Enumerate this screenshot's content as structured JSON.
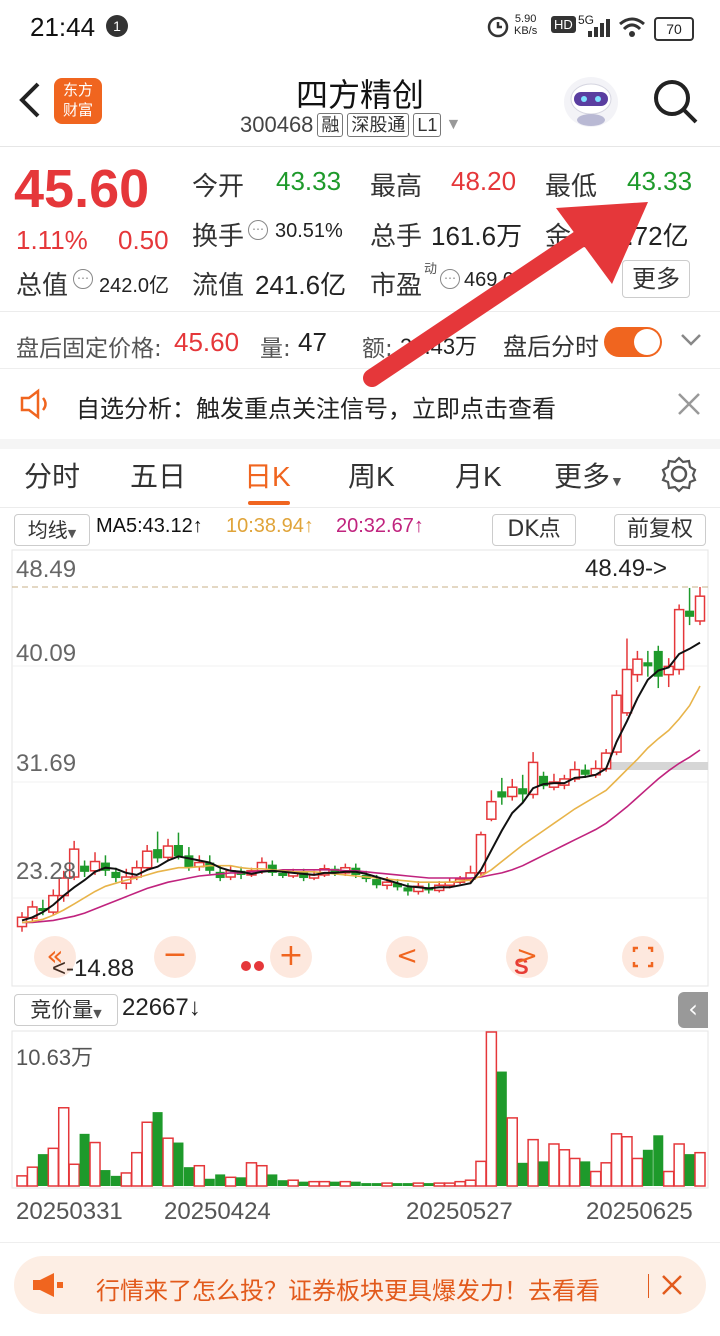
{
  "status_bar": {
    "time": "21:44",
    "notification_count": "1",
    "net_speed_value": "5.90",
    "net_speed_unit": "KB/s",
    "hd": "HD",
    "network": "5G",
    "battery": "70"
  },
  "header": {
    "back_icon": "chevron-left-icon",
    "logo_line1": "东方",
    "logo_line2": "财富",
    "title": "四方精创",
    "code": "300468",
    "tags": [
      "融",
      "深股通",
      "L1"
    ],
    "search_icon": "search-icon"
  },
  "quote": {
    "price": "45.60",
    "change_pct": "1.11%",
    "change_amt": "0.50",
    "open_label": "今开",
    "open": "43.33",
    "high_label": "最高",
    "high": "48.20",
    "low_label": "最低",
    "low": "43.33",
    "turnover_label": "换手",
    "turnover": "30.51%",
    "volume_label": "总手",
    "volume": "161.6万",
    "amount_label": "金额",
    "amount": "5.72亿",
    "mktcap_label": "总值",
    "mktcap": "242.0亿",
    "float_label": "流值",
    "float_val": "241.6亿",
    "pe_label": "市盈",
    "pe_sup": "动",
    "pe": "469.07",
    "more_button": "更多"
  },
  "afterhours": {
    "price_label": "盘后固定价格:",
    "price": "45.60",
    "vol_label": "量:",
    "vol": "47",
    "amt_label": "额:",
    "amt": "21.43万",
    "toggle_label": "盘后分时",
    "toggle_on": true
  },
  "notice": {
    "text": "自选分析：触发重点关注信号，立即点击查看"
  },
  "tabs": [
    "分时",
    "五日",
    "日K",
    "周K",
    "月K",
    "更多"
  ],
  "active_tab": "日K",
  "ma_bar": {
    "selector": "均线",
    "ma5": "MA5:43.12↑",
    "ma10": "10:38.94↑",
    "ma20": "20:32.67↑",
    "dk": "DK点",
    "adjust": "前复权"
  },
  "chart_overlay": {
    "max_marker": "48.49->",
    "min_marker": "14.88",
    "min_prefix": "<-",
    "control_s": "S"
  },
  "volume_bar": {
    "selector": "竞价量",
    "value": "22667↓",
    "ymax_label": "10.63万"
  },
  "colors": {
    "up": "#e5373a",
    "down": "#1e9a2b",
    "ma5": "#111111",
    "ma10": "#e8b44a",
    "ma20": "#c0237e",
    "accent": "#f0651f"
  },
  "banner": {
    "text": "行情来了怎么投？证券板块更具爆发力！去看看"
  },
  "chart_data": {
    "type": "candlestick",
    "y_ticks": [
      "48.49",
      "40.09",
      "31.69",
      "23.28"
    ],
    "ylim": [
      14.88,
      48.49
    ],
    "x_tick_labels": [
      "20250331",
      "20250424",
      "20250527",
      "20250625"
    ],
    "candles": [
      {
        "o": 15.6,
        "c": 16.5,
        "h": 17.0,
        "l": 15.1
      },
      {
        "o": 16.4,
        "c": 17.5,
        "h": 18.1,
        "l": 16.0
      },
      {
        "o": 17.4,
        "c": 17.1,
        "h": 18.2,
        "l": 16.7
      },
      {
        "o": 17.0,
        "c": 18.6,
        "h": 19.2,
        "l": 16.7
      },
      {
        "o": 18.6,
        "c": 20.3,
        "h": 21.0,
        "l": 18.0
      },
      {
        "o": 20.4,
        "c": 23.1,
        "h": 23.9,
        "l": 20.1
      },
      {
        "o": 21.5,
        "c": 20.9,
        "h": 22.0,
        "l": 20.4
      },
      {
        "o": 21.0,
        "c": 21.9,
        "h": 22.8,
        "l": 20.6
      },
      {
        "o": 21.8,
        "c": 21.0,
        "h": 22.5,
        "l": 20.5
      },
      {
        "o": 20.9,
        "c": 20.3,
        "h": 21.3,
        "l": 19.9
      },
      {
        "o": 19.8,
        "c": 20.4,
        "h": 21.2,
        "l": 19.2
      },
      {
        "o": 20.4,
        "c": 21.3,
        "h": 22.0,
        "l": 20.1
      },
      {
        "o": 21.3,
        "c": 22.9,
        "h": 23.5,
        "l": 21.0
      },
      {
        "o": 23.1,
        "c": 22.2,
        "h": 24.8,
        "l": 21.8
      },
      {
        "o": 22.3,
        "c": 23.4,
        "h": 24.1,
        "l": 21.9
      },
      {
        "o": 23.5,
        "c": 22.4,
        "h": 24.7,
        "l": 22.1
      },
      {
        "o": 22.5,
        "c": 21.3,
        "h": 23.3,
        "l": 21.0
      },
      {
        "o": 21.4,
        "c": 21.8,
        "h": 22.5,
        "l": 21.0
      },
      {
        "o": 21.8,
        "c": 21.0,
        "h": 22.5,
        "l": 20.7
      },
      {
        "o": 20.9,
        "c": 20.3,
        "h": 21.5,
        "l": 20.0
      },
      {
        "o": 20.4,
        "c": 21.0,
        "h": 21.5,
        "l": 20.1
      },
      {
        "o": 21.0,
        "c": 20.6,
        "h": 21.4,
        "l": 20.2
      },
      {
        "o": 20.6,
        "c": 21.0,
        "h": 21.3,
        "l": 20.4
      },
      {
        "o": 21.0,
        "c": 21.8,
        "h": 22.3,
        "l": 20.7
      },
      {
        "o": 21.6,
        "c": 20.8,
        "h": 22.0,
        "l": 20.5
      },
      {
        "o": 20.8,
        "c": 20.5,
        "h": 21.1,
        "l": 20.3
      },
      {
        "o": 20.5,
        "c": 20.9,
        "h": 21.2,
        "l": 20.3
      },
      {
        "o": 20.9,
        "c": 20.3,
        "h": 21.2,
        "l": 20.0
      },
      {
        "o": 20.3,
        "c": 20.6,
        "h": 21.0,
        "l": 20.1
      },
      {
        "o": 20.6,
        "c": 21.2,
        "h": 21.6,
        "l": 20.4
      },
      {
        "o": 21.2,
        "c": 20.7,
        "h": 21.5,
        "l": 20.5
      },
      {
        "o": 20.8,
        "c": 21.3,
        "h": 21.7,
        "l": 20.5
      },
      {
        "o": 21.3,
        "c": 20.6,
        "h": 21.7,
        "l": 20.3
      },
      {
        "o": 20.6,
        "c": 20.2,
        "h": 21.0,
        "l": 19.9
      },
      {
        "o": 20.2,
        "c": 19.6,
        "h": 20.6,
        "l": 19.3
      },
      {
        "o": 19.6,
        "c": 19.9,
        "h": 20.4,
        "l": 19.2
      },
      {
        "o": 19.8,
        "c": 19.4,
        "h": 20.2,
        "l": 19.1
      },
      {
        "o": 19.4,
        "c": 19.0,
        "h": 19.8,
        "l": 18.6
      },
      {
        "o": 19.0,
        "c": 19.5,
        "h": 20.0,
        "l": 18.7
      },
      {
        "o": 19.4,
        "c": 19.1,
        "h": 19.8,
        "l": 18.8
      },
      {
        "o": 19.1,
        "c": 19.6,
        "h": 20.0,
        "l": 18.9
      },
      {
        "o": 19.6,
        "c": 19.9,
        "h": 20.3,
        "l": 19.3
      },
      {
        "o": 19.9,
        "c": 20.2,
        "h": 20.5,
        "l": 19.7
      },
      {
        "o": 20.2,
        "c": 20.8,
        "h": 21.5,
        "l": 19.9
      },
      {
        "o": 20.8,
        "c": 24.5,
        "h": 24.8,
        "l": 20.5
      },
      {
        "o": 26.0,
        "c": 27.7,
        "h": 28.8,
        "l": 25.8
      },
      {
        "o": 28.7,
        "c": 28.1,
        "h": 30.0,
        "l": 27.4
      },
      {
        "o": 28.2,
        "c": 29.1,
        "h": 29.9,
        "l": 27.8
      },
      {
        "o": 29.0,
        "c": 28.4,
        "h": 30.3,
        "l": 27.6
      },
      {
        "o": 28.4,
        "c": 31.5,
        "h": 32.5,
        "l": 28.0
      },
      {
        "o": 30.2,
        "c": 29.2,
        "h": 30.6,
        "l": 28.9
      },
      {
        "o": 29.1,
        "c": 29.6,
        "h": 30.4,
        "l": 28.8
      },
      {
        "o": 29.3,
        "c": 29.9,
        "h": 30.3,
        "l": 28.9
      },
      {
        "o": 29.9,
        "c": 30.8,
        "h": 31.6,
        "l": 29.6
      },
      {
        "o": 30.8,
        "c": 30.3,
        "h": 31.3,
        "l": 30.0
      },
      {
        "o": 30.3,
        "c": 30.9,
        "h": 31.7,
        "l": 30.0
      },
      {
        "o": 30.9,
        "c": 32.4,
        "h": 32.8,
        "l": 30.6
      },
      {
        "o": 32.5,
        "c": 38.0,
        "h": 38.5,
        "l": 32.2
      },
      {
        "o": 36.3,
        "c": 40.5,
        "h": 43.5,
        "l": 36.0
      },
      {
        "o": 40.0,
        "c": 41.5,
        "h": 42.3,
        "l": 39.3
      },
      {
        "o": 41.2,
        "c": 40.8,
        "h": 42.3,
        "l": 39.8
      },
      {
        "o": 42.3,
        "c": 39.8,
        "h": 42.8,
        "l": 38.7
      },
      {
        "o": 40.0,
        "c": 40.8,
        "h": 41.6,
        "l": 38.8
      },
      {
        "o": 40.5,
        "c": 46.3,
        "h": 46.8,
        "l": 40.0
      },
      {
        "o": 46.2,
        "c": 45.6,
        "h": 48.4,
        "l": 44.8
      },
      {
        "o": 45.2,
        "c": 47.6,
        "h": 48.49,
        "l": 44.8
      }
    ],
    "ma5": [
      16.2,
      16.5,
      17.0,
      17.7,
      18.6,
      19.4,
      20.1,
      20.9,
      21.3,
      21.2,
      20.8,
      20.6,
      21.1,
      21.4,
      22.0,
      22.4,
      22.2,
      22.0,
      21.8,
      21.3,
      21.0,
      20.9,
      20.7,
      20.9,
      21.0,
      20.9,
      20.8,
      20.7,
      20.6,
      20.8,
      20.8,
      20.9,
      20.9,
      20.7,
      20.4,
      20.1,
      19.8,
      19.5,
      19.4,
      19.3,
      19.4,
      19.4,
      19.6,
      19.8,
      21.1,
      23.0,
      24.9,
      26.6,
      27.6,
      29.0,
      29.4,
      29.5,
      29.5,
      30.0,
      30.1,
      30.3,
      30.9,
      33.5,
      35.5,
      37.7,
      39.5,
      40.4,
      40.7,
      42.0,
      42.5,
      43.1
    ],
    "ma10": [
      16.0,
      16.1,
      16.3,
      16.7,
      17.2,
      17.8,
      18.4,
      19.0,
      19.5,
      19.8,
      20.1,
      20.3,
      20.6,
      20.9,
      21.1,
      21.3,
      21.3,
      21.4,
      21.5,
      21.5,
      21.5,
      21.3,
      21.2,
      21.2,
      21.1,
      21.0,
      20.9,
      20.9,
      20.9,
      20.8,
      20.7,
      20.6,
      20.5,
      20.4,
      20.3,
      20.2,
      20.1,
      20.0,
      19.9,
      19.9,
      19.9,
      19.9,
      20.0,
      20.1,
      20.5,
      21.1,
      21.9,
      22.7,
      23.5,
      24.2,
      24.9,
      25.6,
      26.3,
      27.0,
      27.6,
      28.2,
      28.8,
      29.8,
      30.8,
      31.8,
      32.9,
      33.8,
      34.6,
      35.7,
      37.0,
      38.9
    ],
    "ma20": [
      16.0,
      16.0,
      16.1,
      16.2,
      16.4,
      16.6,
      16.9,
      17.3,
      17.7,
      18.1,
      18.5,
      18.9,
      19.3,
      19.6,
      19.9,
      20.1,
      20.3,
      20.5,
      20.6,
      20.7,
      20.8,
      20.8,
      20.9,
      21.0,
      21.0,
      21.1,
      21.1,
      21.1,
      21.1,
      21.1,
      21.1,
      21.0,
      21.0,
      20.9,
      20.8,
      20.7,
      20.6,
      20.5,
      20.4,
      20.3,
      20.3,
      20.3,
      20.3,
      20.3,
      20.4,
      20.6,
      20.8,
      21.1,
      21.5,
      22.0,
      22.5,
      23.0,
      23.5,
      24.0,
      24.5,
      25.0,
      25.6,
      26.4,
      27.2,
      28.1,
      29.0,
      29.9,
      30.7,
      31.4,
      32.0,
      32.7
    ],
    "volume": [
      0.7,
      1.3,
      2.2,
      2.6,
      5.4,
      1.5,
      3.6,
      3.0,
      1.1,
      0.7,
      0.9,
      2.3,
      4.4,
      5.1,
      3.3,
      3.0,
      1.3,
      1.4,
      0.5,
      0.8,
      0.6,
      0.6,
      1.6,
      1.4,
      0.8,
      0.4,
      0.4,
      0.3,
      0.3,
      0.3,
      0.3,
      0.3,
      0.3,
      0.2,
      0.2,
      0.2,
      0.2,
      0.2,
      0.2,
      0.2,
      0.2,
      0.2,
      0.3,
      0.4,
      1.7,
      10.63,
      7.9,
      4.7,
      1.6,
      3.2,
      1.7,
      2.9,
      2.5,
      1.9,
      1.7,
      1.0,
      1.6,
      3.6,
      3.4,
      1.9,
      2.5,
      3.5,
      1.0,
      2.9,
      2.2,
      2.3
    ],
    "volume_max": 10.63
  }
}
